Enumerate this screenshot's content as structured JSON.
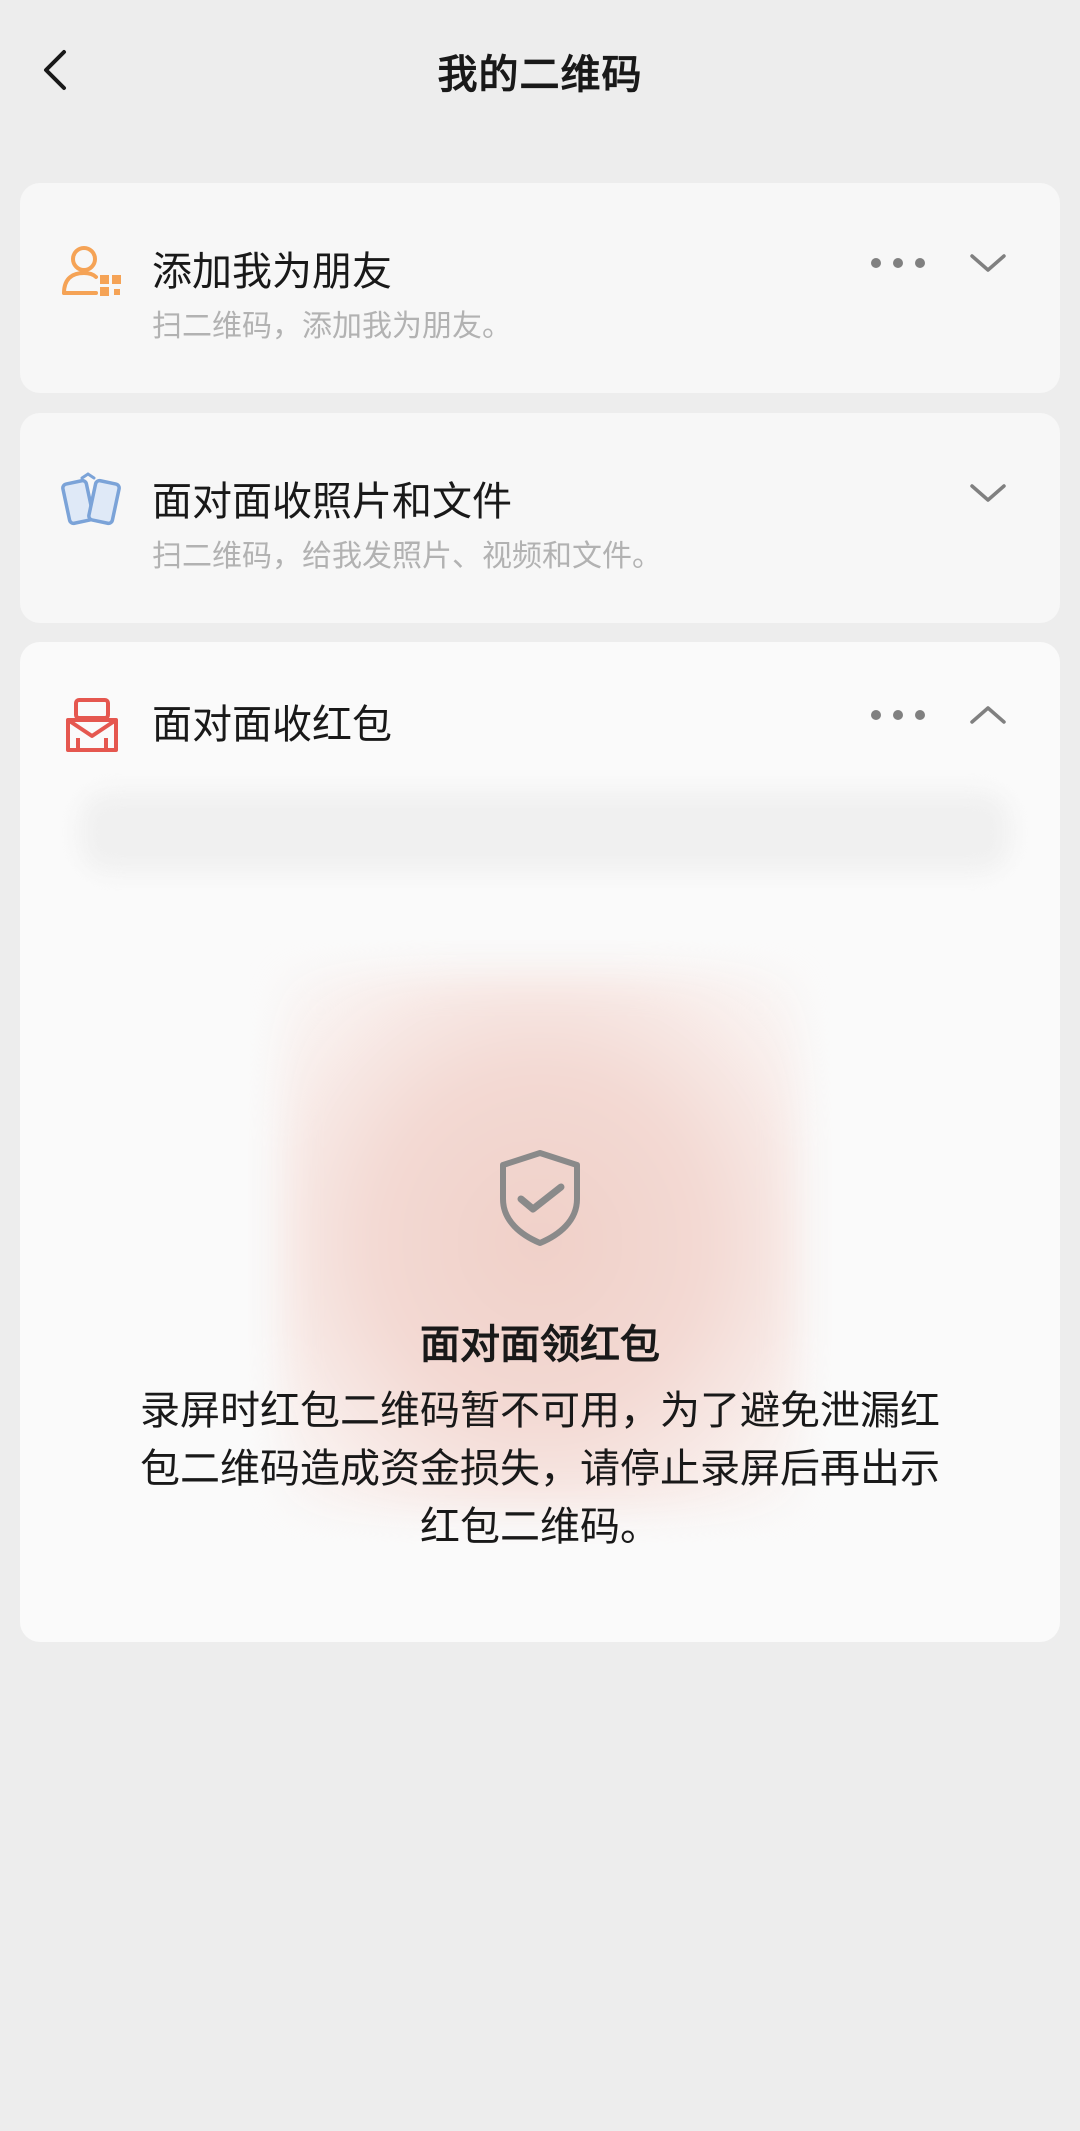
{
  "header": {
    "title": "我的二维码"
  },
  "cards": [
    {
      "title": "添加我为朋友",
      "subtitle": "扫二维码，添加我为朋友。",
      "icon": "person-qr-icon",
      "accent": "#f5a356",
      "has_more": true,
      "expanded": false
    },
    {
      "title": "面对面收照片和文件",
      "subtitle": "扫二维码，给我发照片、视频和文件。",
      "icon": "phones-transfer-icon",
      "accent": "#7ba3d8",
      "has_more": false,
      "expanded": false
    },
    {
      "title": "面对面收红包",
      "subtitle": "",
      "icon": "red-packet-icon",
      "accent": "#e5574f",
      "has_more": true,
      "expanded": true
    }
  ],
  "red_packet": {
    "title": "面对面领红包",
    "message": "录屏时红包二维码暂不可用，为了避免泄漏红包二维码造成资金损失，请停止录屏后再出示红包二维码。",
    "icon": "shield-check-icon"
  }
}
